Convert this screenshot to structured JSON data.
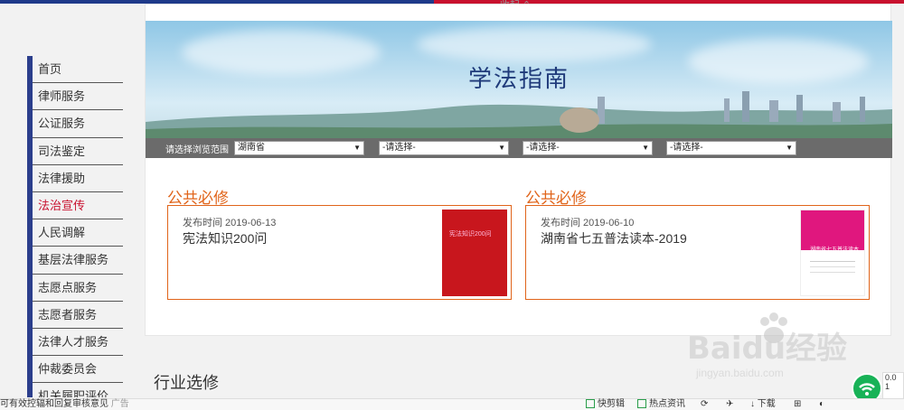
{
  "collapse_label": "收起",
  "sidebar": {
    "items": [
      {
        "label": "首页"
      },
      {
        "label": "律师服务"
      },
      {
        "label": "公证服务"
      },
      {
        "label": "司法鉴定"
      },
      {
        "label": "法律援助"
      },
      {
        "label": "法治宣传",
        "active": true
      },
      {
        "label": "人民调解"
      },
      {
        "label": "基层法律服务"
      },
      {
        "label": "志愿点服务"
      },
      {
        "label": "志愿者服务"
      },
      {
        "label": "法律人才服务"
      },
      {
        "label": "仲裁委员会"
      },
      {
        "label": "机关履职评价"
      }
    ]
  },
  "banner": {
    "title": "学法指南"
  },
  "filter": {
    "label": "请选择浏览范围",
    "selects": [
      "湖南省",
      "-请选择-",
      "-请选择-",
      "-请选择-"
    ]
  },
  "cards": [
    {
      "section": "公共必修",
      "date": "发布时间 2019-06-13",
      "title": "宪法知识200问",
      "cover_text": "宪法知识200问"
    },
    {
      "section": "公共必修",
      "date": "发布时间 2019-06-10",
      "title": "湖南省七五普法读本-2019",
      "cover_text": "湖南省七五普法读本"
    }
  ],
  "industry_title": "行业选修",
  "watermark": {
    "brand": "Baidu经验",
    "url": "jingyan.baidu.com"
  },
  "widgets": {
    "net_value": "0.0",
    "count": "1"
  },
  "statusbar": {
    "left_text": "可有效控辐和回复审核意见",
    "ad_label": "广告",
    "items": [
      "快剪辑",
      "热点资讯",
      "下载"
    ]
  },
  "colors": {
    "accent": "#e0641a",
    "nav_blue": "#2b3e8c",
    "active_red": "#c8102e",
    "filter_bg": "#6b6b6b"
  }
}
